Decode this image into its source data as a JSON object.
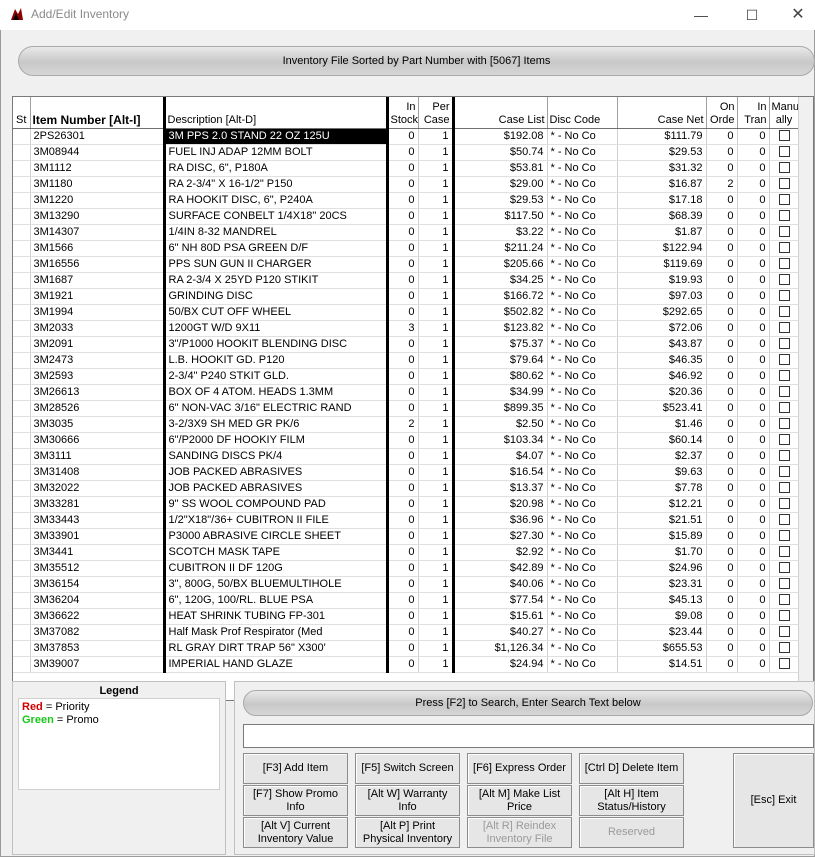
{
  "window": {
    "title": "Add/Edit Inventory",
    "minimize": "—",
    "maximize": "☐",
    "close": "✕"
  },
  "banner": "Inventory File Sorted by Part Number with [5067] Items",
  "columns": {
    "st": "St",
    "item": "Item Number [Alt-I]",
    "desc": "Description [Alt-D]",
    "instock": "In Stock",
    "percase": "Per Case",
    "caselist": "Case List",
    "disccode": "Disc Code",
    "casenet": "Case Net",
    "onorder": "On Orde",
    "intran": "In Tran",
    "manually": "Manu ally"
  },
  "rows": [
    {
      "item": "2PS26301",
      "desc": "3M PPS 2.0 STAND 22 OZ 125U",
      "instock": "0",
      "percase": "1",
      "caselist": "$192.08",
      "disc": "* - No Co",
      "casenet": "$111.79",
      "onorder": "0",
      "intran": "0"
    },
    {
      "item": "3M08944",
      "desc": "FUEL INJ ADAP 12MM BOLT",
      "instock": "0",
      "percase": "1",
      "caselist": "$50.74",
      "disc": "* - No Co",
      "casenet": "$29.53",
      "onorder": "0",
      "intran": "0"
    },
    {
      "item": "3M1112",
      "desc": "RA  DISC, 6\", P180A",
      "instock": "0",
      "percase": "1",
      "caselist": "$53.81",
      "disc": "* - No Co",
      "casenet": "$31.32",
      "onorder": "0",
      "intran": "0"
    },
    {
      "item": "3M1180",
      "desc": "RA 2-3/4\" X 16-1/2\" P150",
      "instock": "0",
      "percase": "1",
      "caselist": "$29.00",
      "disc": "* - No Co",
      "casenet": "$16.87",
      "onorder": "2",
      "intran": "0"
    },
    {
      "item": "3M1220",
      "desc": "RA HOOKIT DISC, 6\", P240A",
      "instock": "0",
      "percase": "1",
      "caselist": "$29.53",
      "disc": "* - No Co",
      "casenet": "$17.18",
      "onorder": "0",
      "intran": "0"
    },
    {
      "item": "3M13290",
      "desc": "SURFACE CONBELT 1/4X18\" 20CS",
      "instock": "0",
      "percase": "1",
      "caselist": "$117.50",
      "disc": "* - No Co",
      "casenet": "$68.39",
      "onorder": "0",
      "intran": "0"
    },
    {
      "item": "3M14307",
      "desc": "1/4IN 8-32 MANDREL",
      "instock": "0",
      "percase": "1",
      "caselist": "$3.22",
      "disc": "* - No Co",
      "casenet": "$1.87",
      "onorder": "0",
      "intran": "0"
    },
    {
      "item": "3M1566",
      "desc": "6\" NH 80D PSA GREEN D/F",
      "instock": "0",
      "percase": "1",
      "caselist": "$211.24",
      "disc": "* - No Co",
      "casenet": "$122.94",
      "onorder": "0",
      "intran": "0"
    },
    {
      "item": "3M16556",
      "desc": "PPS SUN GUN II CHARGER",
      "instock": "0",
      "percase": "1",
      "caselist": "$205.66",
      "disc": "* - No Co",
      "casenet": "$119.69",
      "onorder": "0",
      "intran": "0"
    },
    {
      "item": "3M1687",
      "desc": "RA 2-3/4 X 25YD P120 STIKIT",
      "instock": "0",
      "percase": "1",
      "caselist": "$34.25",
      "disc": "* - No Co",
      "casenet": "$19.93",
      "onorder": "0",
      "intran": "0"
    },
    {
      "item": "3M1921",
      "desc": "GRINDING DISC",
      "instock": "0",
      "percase": "1",
      "caselist": "$166.72",
      "disc": "* - No Co",
      "casenet": "$97.03",
      "onorder": "0",
      "intran": "0"
    },
    {
      "item": "3M1994",
      "desc": "50/BX CUT OFF WHEEL",
      "instock": "0",
      "percase": "1",
      "caselist": "$502.82",
      "disc": "* - No Co",
      "casenet": "$292.65",
      "onorder": "0",
      "intran": "0"
    },
    {
      "item": "3M2033",
      "desc": "1200GT W/D 9X11",
      "instock": "3",
      "percase": "1",
      "caselist": "$123.82",
      "disc": "* - No Co",
      "casenet": "$72.06",
      "onorder": "0",
      "intran": "0"
    },
    {
      "item": "3M2091",
      "desc": "3\"/P1000 HOOKIT BLENDING DISC",
      "instock": "0",
      "percase": "1",
      "caselist": "$75.37",
      "disc": "* - No Co",
      "casenet": "$43.87",
      "onorder": "0",
      "intran": "0"
    },
    {
      "item": "3M2473",
      "desc": "L.B. HOOKIT GD. P120",
      "instock": "0",
      "percase": "1",
      "caselist": "$79.64",
      "disc": "* - No Co",
      "casenet": "$46.35",
      "onorder": "0",
      "intran": "0"
    },
    {
      "item": "3M2593",
      "desc": "2-3/4\" P240 STKIT GLD.",
      "instock": "0",
      "percase": "1",
      "caselist": "$80.62",
      "disc": "* - No Co",
      "casenet": "$46.92",
      "onorder": "0",
      "intran": "0"
    },
    {
      "item": "3M26613",
      "desc": "BOX OF 4 ATOM. HEADS 1.3MM",
      "instock": "0",
      "percase": "1",
      "caselist": "$34.99",
      "disc": "* - No Co",
      "casenet": "$20.36",
      "onorder": "0",
      "intran": "0"
    },
    {
      "item": "3M28526",
      "desc": "6\" NON-VAC 3/16\" ELECTRIC RAND",
      "instock": "0",
      "percase": "1",
      "caselist": "$899.35",
      "disc": "* - No Co",
      "casenet": "$523.41",
      "onorder": "0",
      "intran": "0"
    },
    {
      "item": "3M3035",
      "desc": "3-2/3X9 SH MED GR  PK/6",
      "instock": "2",
      "percase": "1",
      "caselist": "$2.50",
      "disc": "* - No Co",
      "casenet": "$1.46",
      "onorder": "0",
      "intran": "0"
    },
    {
      "item": "3M30666",
      "desc": "6\"/P2000 DF HOOKIY FILM",
      "instock": "0",
      "percase": "1",
      "caselist": "$103.34",
      "disc": "* - No Co",
      "casenet": "$60.14",
      "onorder": "0",
      "intran": "0"
    },
    {
      "item": "3M3111",
      "desc": "SANDING DISCS  PK/4",
      "instock": "0",
      "percase": "1",
      "caselist": "$4.07",
      "disc": "* - No Co",
      "casenet": "$2.37",
      "onorder": "0",
      "intran": "0"
    },
    {
      "item": "3M31408",
      "desc": "JOB PACKED ABRASIVES",
      "instock": "0",
      "percase": "1",
      "caselist": "$16.54",
      "disc": "* - No Co",
      "casenet": "$9.63",
      "onorder": "0",
      "intran": "0"
    },
    {
      "item": "3M32022",
      "desc": "JOB PACKED ABRASIVES",
      "instock": "0",
      "percase": "1",
      "caselist": "$13.37",
      "disc": "* - No Co",
      "casenet": "$7.78",
      "onorder": "0",
      "intran": "0"
    },
    {
      "item": "3M33281",
      "desc": "9\" SS WOOL COMPOUND PAD",
      "instock": "0",
      "percase": "1",
      "caselist": "$20.98",
      "disc": "* - No Co",
      "casenet": "$12.21",
      "onorder": "0",
      "intran": "0"
    },
    {
      "item": "3M33443",
      "desc": "1/2\"X18\"/36+ CUBITRON II FILE",
      "instock": "0",
      "percase": "1",
      "caselist": "$36.96",
      "disc": "* - No Co",
      "casenet": "$21.51",
      "onorder": "0",
      "intran": "0"
    },
    {
      "item": "3M33901",
      "desc": "P3000 ABRASIVE CIRCLE SHEET",
      "instock": "0",
      "percase": "1",
      "caselist": "$27.30",
      "disc": "* - No Co",
      "casenet": "$15.89",
      "onorder": "0",
      "intran": "0"
    },
    {
      "item": "3M3441",
      "desc": "SCOTCH MASK TAPE",
      "instock": "0",
      "percase": "1",
      "caselist": "$2.92",
      "disc": "* - No Co",
      "casenet": "$1.70",
      "onorder": "0",
      "intran": "0"
    },
    {
      "item": "3M35512",
      "desc": "CUBITRON II DF 120G",
      "instock": "0",
      "percase": "1",
      "caselist": "$42.89",
      "disc": "* - No Co",
      "casenet": "$24.96",
      "onorder": "0",
      "intran": "0"
    },
    {
      "item": "3M36154",
      "desc": "3\", 800G, 50/BX BLUEMULTIHOLE",
      "instock": "0",
      "percase": "1",
      "caselist": "$40.06",
      "disc": "* - No Co",
      "casenet": "$23.31",
      "onorder": "0",
      "intran": "0"
    },
    {
      "item": "3M36204",
      "desc": "6\", 120G, 100/RL. BLUE PSA",
      "instock": "0",
      "percase": "1",
      "caselist": "$77.54",
      "disc": "* - No Co",
      "casenet": "$45.13",
      "onorder": "0",
      "intran": "0"
    },
    {
      "item": "3M36622",
      "desc": "HEAT SHRINK TUBING FP-301",
      "instock": "0",
      "percase": "1",
      "caselist": "$15.61",
      "disc": "* - No Co",
      "casenet": "$9.08",
      "onorder": "0",
      "intran": "0"
    },
    {
      "item": "3M37082",
      "desc": "Half Mask Prof Respirator (Med",
      "instock": "0",
      "percase": "1",
      "caselist": "$40.27",
      "disc": "* - No Co",
      "casenet": "$23.44",
      "onorder": "0",
      "intran": "0"
    },
    {
      "item": "3M37853",
      "desc": "RL GRAY DIRT TRAP 56\" X300'",
      "instock": "0",
      "percase": "1",
      "caselist": "$1,126.34",
      "disc": "* - No Co",
      "casenet": "$655.53",
      "onorder": "0",
      "intran": "0"
    },
    {
      "item": "3M39007",
      "desc": "IMPERIAL HAND GLAZE",
      "instock": "0",
      "percase": "1",
      "caselist": "$24.94",
      "disc": "* - No Co",
      "casenet": "$14.51",
      "onorder": "0",
      "intran": "0"
    }
  ],
  "legend": {
    "title": "Legend",
    "red_word": "Red",
    "red_rest": " = Priority",
    "green_word": "Green",
    "green_rest": " = Promo",
    "red_color": "#d00000",
    "green_color": "#19c619"
  },
  "search": {
    "banner": "Press [F2] to Search, Enter Search Text below",
    "value": ""
  },
  "buttons": {
    "add_item": "[F3] Add Item",
    "switch_screen": "[F5] Switch Screen",
    "express_order": "[F6] Express Order",
    "delete_item": "[Ctrl D] Delete Item",
    "show_promo": "[F7] Show Promo Info",
    "warranty": "[Alt W] Warranty Info",
    "make_list": "[Alt M] Make List Price",
    "item_status": "[Alt H] Item Status/History",
    "current_inv": "[Alt V] Current Inventory Value",
    "print_physical": "[Alt P] Print Physical Inventory",
    "reindex": "[Alt R] Reindex Inventory File",
    "reserved": "Reserved",
    "exit": "[Esc] Exit"
  }
}
